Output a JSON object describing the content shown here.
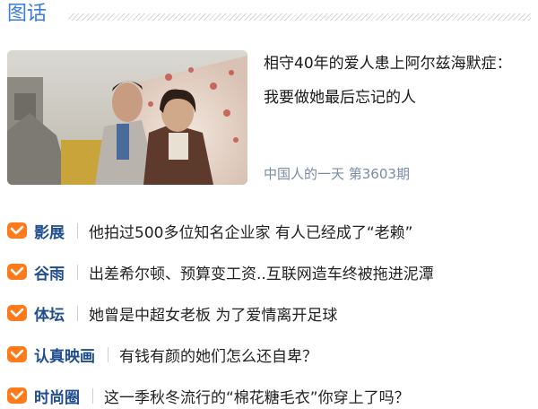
{
  "section": {
    "title": "图话"
  },
  "feature": {
    "headline": "相守40年的爱人患上阿尔兹海默症：我要做她最后忘记的人",
    "meta": "中国人的一天 第3603期",
    "photo_icon": "couple-photo"
  },
  "news": [
    {
      "tag": "影展",
      "title": "他拍过500多位知名企业家 有人已经成了“老赖”",
      "icon": "tag-chevron-icon"
    },
    {
      "tag": "谷雨",
      "title": "出差希尔顿、预算变工资..互联网造车终被拖进泥潭",
      "icon": "tag-chevron-icon"
    },
    {
      "tag": "体坛",
      "title": "她曾是中超女老板 为了爱情离开足球",
      "icon": "tag-chevron-icon"
    },
    {
      "tag": "认真映画",
      "title": "有钱有颜的她们怎么还自卑？",
      "icon": "tag-chevron-icon"
    },
    {
      "tag": "时尚圈",
      "title": "这一季秋冬流行的“棉花糖毛衣”你穿上了吗？",
      "icon": "tag-chevron-icon"
    }
  ],
  "colors": {
    "accent": "#3a7ed8",
    "tag": "#1f4d8f",
    "icon": "#ff7a1a",
    "meta": "#7a8ca6"
  }
}
